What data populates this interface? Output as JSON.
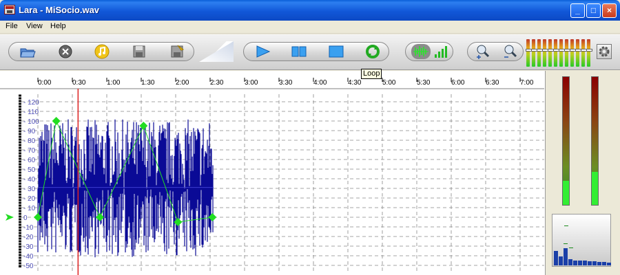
{
  "window": {
    "title": "Lara - MiSocio.wav",
    "min": "_",
    "max": "□",
    "close": "×"
  },
  "menu": [
    "File",
    "View",
    "Help"
  ],
  "tooltip": "Loop",
  "toolbar": {
    "file_group": [
      "open-folder-icon",
      "close-file-icon",
      "music-note-icon",
      "save-icon",
      "save-as-icon"
    ],
    "playback_group": [
      "play-icon",
      "play-selection-icon",
      "stop-icon",
      "loop-icon"
    ],
    "view_group": [
      "waveform-view-icon",
      "level-view-icon"
    ],
    "zoom_group": [
      "zoom-in-icon",
      "zoom-out-icon"
    ]
  },
  "timeline": {
    "labels": [
      "0:00",
      "0:30",
      "1:00",
      "1:30",
      "2:00",
      "2:30",
      "3:00",
      "3:30",
      "4:00",
      "4:30",
      "5:00",
      "5:30",
      "6:00",
      "6:30",
      "7:00"
    ],
    "seconds_per_label": 30
  },
  "chart_data": {
    "type": "line",
    "title": "",
    "xlabel": "",
    "ylabel": "",
    "y_tick_labels": [
      120,
      110,
      100,
      90,
      80,
      70,
      60,
      50,
      40,
      30,
      20,
      10,
      0,
      -10,
      -20,
      -30,
      -40,
      -50
    ],
    "ylim": [
      -50,
      120
    ],
    "x_unit": "seconds",
    "xlim": [
      0,
      435
    ],
    "audio_duration": 153,
    "playhead": 35,
    "colors": {
      "waveform": "#0a0a96",
      "envelope": "#22dd22",
      "playhead": "#dd2222",
      "grid": "#888888",
      "axis": "#5050b8"
    },
    "series": [
      {
        "points": [
          [
            0,
            0
          ],
          [
            16,
            100
          ],
          [
            54,
            0
          ],
          [
            92,
            95
          ],
          [
            122,
            -5
          ],
          [
            152,
            0
          ]
        ]
      }
    ]
  },
  "meters": {
    "left_level": 0.19,
    "right_level": 0.26
  },
  "spectrum": {
    "levels": [
      0.28,
      0.18,
      0.34,
      0.12,
      0.1,
      0.09,
      0.09,
      0.08,
      0.08,
      0.07,
      0.07,
      0.06
    ]
  },
  "colors": {
    "titlebar": "#0c49c4",
    "panel": "#ece9d8",
    "meter_green": "#33ee33"
  }
}
